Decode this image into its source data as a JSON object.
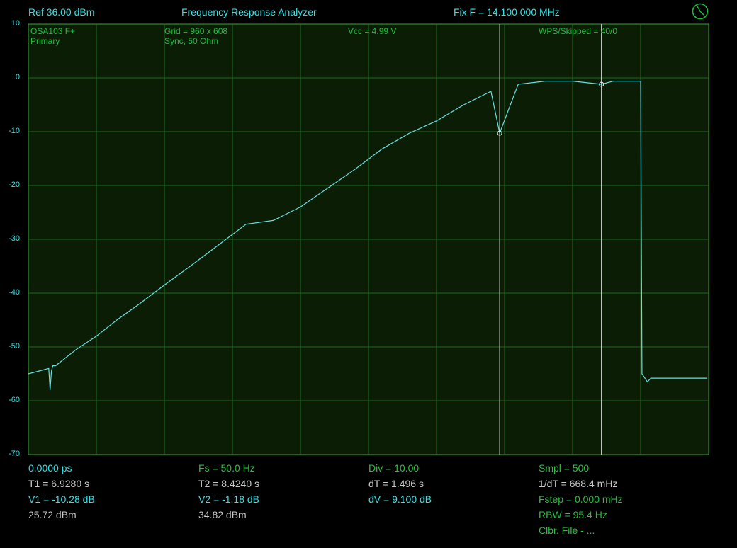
{
  "header": {
    "ref": "Ref  36.00 dBm",
    "title": "Frequency Response Analyzer",
    "fix": "Fix F = 14.100 000 MHz"
  },
  "overlay": {
    "model": "OSA103 F+",
    "channel": "Primary",
    "grid": "Grid = 960 x 608",
    "sync": "Sync, 50 Ohm",
    "vcc": "Vcc = 4.99 V",
    "wps": "WPS/Skipped   = 40/0"
  },
  "y_ticks": [
    "10",
    "0",
    "-10",
    "-20",
    "-30",
    "-40",
    "-50",
    "-60",
    "-70"
  ],
  "footer": {
    "col1": [
      "0.0000 ps",
      "T1 = 6.9280 s",
      "V1 = -10.28 dB",
      "25.72 dBm"
    ],
    "col2": [
      "Fs = 50.0 Hz",
      "T2 = 8.4240 s",
      "V2 = -1.18 dB",
      "34.82 dBm"
    ],
    "col3": [
      "Div = 10.00",
      "dT = 1.496 s",
      "dV = 9.100 dB"
    ],
    "col4": [
      "Smpl = 500",
      "1/dT = 668.4 mHz",
      "Fstep = 0.000 mHz",
      "RBW = 95.4 Hz",
      "Clbr. File - ..."
    ]
  },
  "colors": {
    "background": "#000000",
    "plot_bg": "#0b1d05",
    "grid": "#1e6a1e",
    "trace": "#66e0e0",
    "text_cyan": "#2fe3e6",
    "text_green": "#27c23d",
    "text_grey": "#c8c8c8"
  },
  "chart_data": {
    "type": "line",
    "ylim": [
      -70,
      10
    ],
    "y_divisions": 8,
    "x_divisions": 10,
    "series": [
      {
        "x": [
          0,
          0.3,
          0.32,
          0.34,
          0.36,
          0.4,
          0.5,
          0.7,
          1.0,
          1.3,
          1.6,
          2.0,
          2.4,
          2.8,
          3.2,
          3.6,
          4.0,
          4.4,
          4.8,
          5.2,
          5.6,
          6.0,
          6.4,
          6.8,
          6.928,
          7.2,
          7.6,
          8.0,
          8.424,
          8.6,
          9.0,
          9.02,
          9.1,
          9.15,
          9.5,
          9.98
        ],
        "y": [
          -55,
          -54,
          -58,
          -54.5,
          -53.5,
          -53.5,
          -52.5,
          -50.5,
          -48,
          -45,
          -42.3,
          -38.5,
          -34.8,
          -31,
          -27.2,
          -26.5,
          -24,
          -20.5,
          -17,
          -13.2,
          -10.28,
          -8,
          -5,
          -2.5,
          -10.28,
          -1.18,
          -0.6,
          -0.6,
          -1.18,
          -0.6,
          -0.6,
          -55,
          -56.5,
          -55.8,
          -55.8,
          -55.8
        ]
      }
    ],
    "cursors": [
      {
        "x": 6.928,
        "y": -10.28
      },
      {
        "x": 8.424,
        "y": -1.18
      }
    ]
  }
}
